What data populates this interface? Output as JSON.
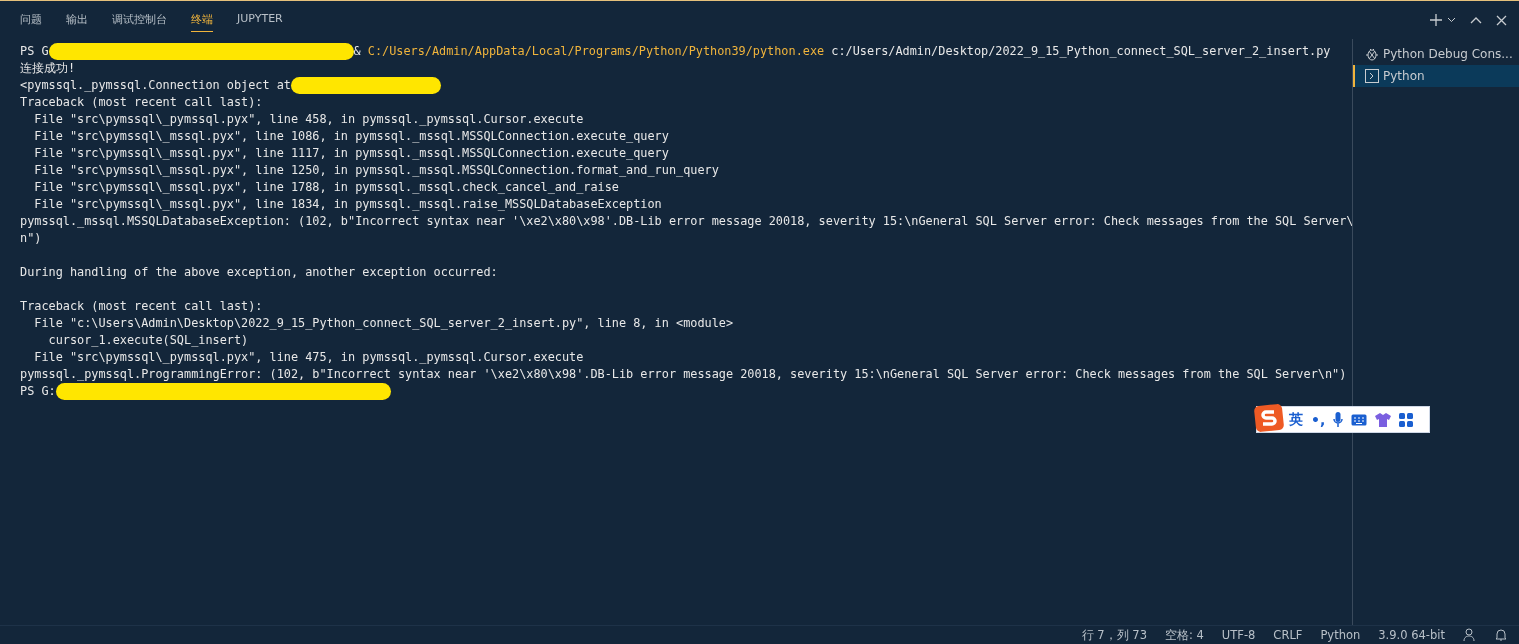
{
  "tabs": [
    {
      "label": "问题",
      "selected": false
    },
    {
      "label": "输出",
      "selected": false
    },
    {
      "label": "调试控制台",
      "selected": false
    },
    {
      "label": "终端",
      "selected": true
    },
    {
      "label": "JUPYTER",
      "selected": false
    }
  ],
  "terminal": {
    "lines": [
      {
        "kind": "output",
        "segments": [
          {
            "kind": "text",
            "text": "PS G"
          },
          {
            "kind": "redaction"
          },
          {
            "kind": "text",
            "text": "& "
          },
          {
            "kind": "path",
            "text": "C:/Users/Admin/AppData/Local/Programs/Python/Python39/python.exe"
          },
          {
            "kind": "text",
            "text": " c:/Users/Admin/Desktop/2022_9_15_Python_connect_SQL_server_2_insert.py"
          }
        ]
      },
      {
        "kind": "output",
        "segments": [
          {
            "kind": "text",
            "text": "连接成功!"
          }
        ]
      },
      {
        "kind": "output",
        "segments": [
          {
            "kind": "text",
            "text": "<pymssql._pymssql.Connection object at"
          },
          {
            "kind": "redaction"
          }
        ]
      },
      {
        "kind": "output",
        "segments": [
          {
            "kind": "text",
            "text": "Traceback (most recent call last):"
          }
        ]
      },
      {
        "kind": "output",
        "segments": [
          {
            "kind": "text",
            "text": "  File \"src\\pymssql\\_pymssql.pyx\", line 458, in pymssql._pymssql.Cursor.execute"
          }
        ]
      },
      {
        "kind": "output",
        "segments": [
          {
            "kind": "text",
            "text": "  File \"src\\pymssql\\_mssql.pyx\", line 1086, in pymssql._mssql.MSSQLConnection.execute_query"
          }
        ]
      },
      {
        "kind": "output",
        "segments": [
          {
            "kind": "text",
            "text": "  File \"src\\pymssql\\_mssql.pyx\", line 1117, in pymssql._mssql.MSSQLConnection.execute_query"
          }
        ]
      },
      {
        "kind": "output",
        "segments": [
          {
            "kind": "text",
            "text": "  File \"src\\pymssql\\_mssql.pyx\", line 1250, in pymssql._mssql.MSSQLConnection.format_and_run_query"
          }
        ]
      },
      {
        "kind": "output",
        "segments": [
          {
            "kind": "text",
            "text": "  File \"src\\pymssql\\_mssql.pyx\", line 1788, in pymssql._mssql.check_cancel_and_raise"
          }
        ]
      },
      {
        "kind": "output",
        "segments": [
          {
            "kind": "text",
            "text": "  File \"src\\pymssql\\_mssql.pyx\", line 1834, in pymssql._mssql.raise_MSSQLDatabaseException"
          }
        ]
      },
      {
        "kind": "output",
        "segments": [
          {
            "kind": "text",
            "text": "pymssql._mssql.MSSQLDatabaseException: (102, b\"Incorrect syntax near '\\xe2\\x80\\x98'.DB-Lib error message 20018, severity 15:\\nGeneral SQL Server error: Check messages from the SQL Server\\"
          }
        ]
      },
      {
        "kind": "output",
        "segments": [
          {
            "kind": "text",
            "text": "n\")"
          }
        ]
      },
      {
        "kind": "blank"
      },
      {
        "kind": "output",
        "segments": [
          {
            "kind": "text",
            "text": "During handling of the above exception, another exception occurred:"
          }
        ]
      },
      {
        "kind": "blank"
      },
      {
        "kind": "output",
        "segments": [
          {
            "kind": "text",
            "text": "Traceback (most recent call last):"
          }
        ]
      },
      {
        "kind": "output",
        "segments": [
          {
            "kind": "text",
            "text": "  File \"c:\\Users\\Admin\\Desktop\\2022_9_15_Python_connect_SQL_server_2_insert.py\", line 8, in <module>"
          }
        ]
      },
      {
        "kind": "output",
        "segments": [
          {
            "kind": "text",
            "text": "    cursor_1.execute(SQL_insert)"
          }
        ]
      },
      {
        "kind": "output",
        "segments": [
          {
            "kind": "text",
            "text": "  File \"src\\pymssql\\_pymssql.pyx\", line 475, in pymssql._pymssql.Cursor.execute"
          }
        ]
      },
      {
        "kind": "output",
        "segments": [
          {
            "kind": "text",
            "text": "pymssql._pymssql.ProgrammingError: (102, b\"Incorrect syntax near '\\xe2\\x80\\x98'.DB-Lib error message 20018, severity 15:\\nGeneral SQL Server error: Check messages from the SQL Server\\n\")"
          }
        ]
      },
      {
        "kind": "output",
        "segments": [
          {
            "kind": "text",
            "text": "PS G:"
          },
          {
            "kind": "redaction"
          }
        ]
      }
    ]
  },
  "terminal_list": [
    {
      "kind": "debug",
      "label": "Python Debug Cons...",
      "selected": false
    },
    {
      "kind": "shell",
      "label": "Python",
      "selected": true
    }
  ],
  "ime_toolbar": {
    "language": "英",
    "punctuation": "•,"
  },
  "status_bar": [
    "行 7，列 73",
    "空格: 4",
    "UTF-8",
    "CRLF",
    "Python",
    "3.9.0 64-bit"
  ]
}
